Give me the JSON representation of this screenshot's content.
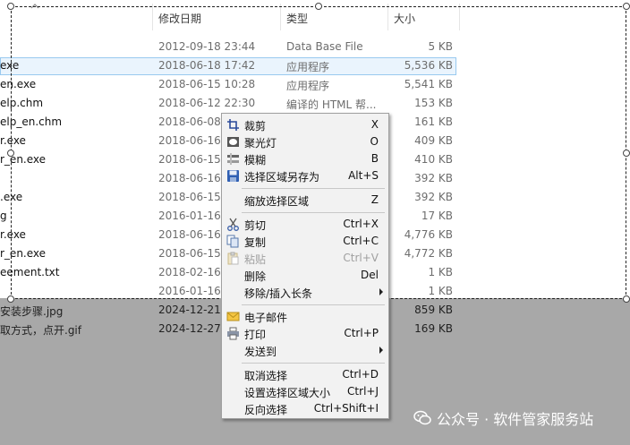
{
  "columns": {
    "date": "修改日期",
    "type": "类型",
    "size": "大小"
  },
  "files": [
    {
      "name": "",
      "date": "2012-09-18 23:44",
      "type": "Data Base File",
      "size": "5 KB"
    },
    {
      "name": "exe",
      "date": "2018-06-18 17:42",
      "type": "应用程序",
      "size": "5,536 KB",
      "selected": true
    },
    {
      "name": "en.exe",
      "date": "2018-06-15 10:28",
      "type": "应用程序",
      "size": "5,541 KB"
    },
    {
      "name": "elp.chm",
      "date": "2018-06-12 22:30",
      "type": "编译的 HTML 帮...",
      "size": "153 KB"
    },
    {
      "name": "elp_en.chm",
      "date": "2018-06-08",
      "type": "",
      "size": "161 KB"
    },
    {
      "name": "r.exe",
      "date": "2018-06-16",
      "type": "",
      "size": "409 KB"
    },
    {
      "name": "r_en.exe",
      "date": "2018-06-15",
      "type": "",
      "size": "410 KB"
    },
    {
      "name": "",
      "date": "2018-06-16",
      "type": "",
      "size": "392 KB"
    },
    {
      "name": ".exe",
      "date": "2018-06-15",
      "type": "",
      "size": "392 KB"
    },
    {
      "name": "g",
      "date": "2016-01-16",
      "type": "",
      "size": "17 KB"
    },
    {
      "name": "r.exe",
      "date": "2018-06-16",
      "type": "",
      "size": "4,776 KB"
    },
    {
      "name": "r_en.exe",
      "date": "2018-06-15",
      "type": "",
      "size": "4,772 KB"
    },
    {
      "name": "eement.txt",
      "date": "2018-02-16",
      "type": "",
      "size": "1 KB"
    },
    {
      "name": "",
      "date": "2016-01-16",
      "type": "",
      "size": "1 KB"
    },
    {
      "name": "安装步骤.jpg",
      "date": "2024-12-21",
      "type": "",
      "size": "859 KB",
      "dim": true
    },
    {
      "name": "取方式，点开.gif",
      "date": "2024-12-27",
      "type": "",
      "size": "169 KB",
      "dim": true
    }
  ],
  "menu": {
    "crop": {
      "label": "裁剪",
      "shortcut": "X"
    },
    "spotlight": {
      "label": "聚光灯",
      "shortcut": "O"
    },
    "blur": {
      "label": "模糊",
      "shortcut": "B"
    },
    "save_region": {
      "label": "选择区域另存为",
      "shortcut": "Alt+S"
    },
    "zoom_region": {
      "label": "缩放选择区域",
      "shortcut": "Z"
    },
    "cut": {
      "label": "剪切",
      "shortcut": "Ctrl+X"
    },
    "copy": {
      "label": "复制",
      "shortcut": "Ctrl+C"
    },
    "paste": {
      "label": "粘贴",
      "shortcut": "Ctrl+V"
    },
    "delete": {
      "label": "删除",
      "shortcut": "Del"
    },
    "remove_insert": {
      "label": "移除/插入长条"
    },
    "email": {
      "label": "电子邮件"
    },
    "print": {
      "label": "打印",
      "shortcut": "Ctrl+P"
    },
    "send_to": {
      "label": "发送到"
    },
    "deselect": {
      "label": "取消选择",
      "shortcut": "Ctrl+D"
    },
    "set_size": {
      "label": "设置选择区域大小",
      "shortcut": "Ctrl+J"
    },
    "invert": {
      "label": "反向选择",
      "shortcut": "Ctrl+Shift+I"
    }
  },
  "watermark": {
    "text": "公众号 · 软件管家服务站"
  }
}
